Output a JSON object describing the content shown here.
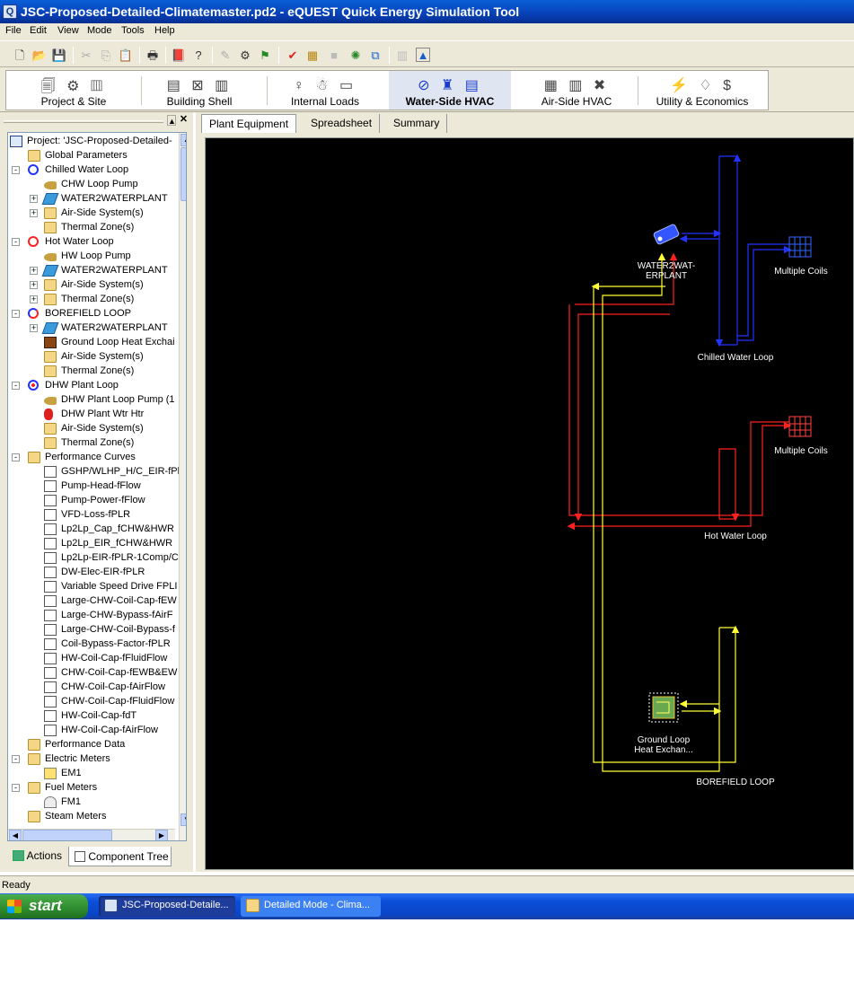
{
  "window": {
    "title": "JSC-Proposed-Detailed-Climatemaster.pd2 - eQUEST Quick Energy Simulation Tool"
  },
  "menu": [
    "File",
    "Edit",
    "View",
    "Mode",
    "Tools",
    "Help"
  ],
  "toolbar_icons": [
    "new-file",
    "open-folder",
    "save",
    "cut",
    "copy",
    "paste",
    "print",
    "library",
    "help",
    "edit-component",
    "wizard",
    "flag",
    "check",
    "spreadsheet",
    "blank",
    "gear",
    "link",
    "blank",
    "image"
  ],
  "modes": [
    {
      "label": "Project & Site",
      "icons": "🗐 ⚙ ▥",
      "active": false
    },
    {
      "label": "Building Shell",
      "icons": "▤ ⊠ ▥",
      "active": false
    },
    {
      "label": "Internal Loads",
      "icons": "♀ ☃ ▭",
      "active": false
    },
    {
      "label": "Water-Side HVAC",
      "icons": "⊘ ♜ ▤",
      "active": true
    },
    {
      "label": "Air-Side HVAC",
      "icons": "▦ ▥ ✖",
      "active": false
    },
    {
      "label": "Utility & Economics",
      "icons": "⚡ ♢ $",
      "active": false
    }
  ],
  "tree": [
    {
      "label": "Project:  'JSC-Proposed-Detailed-",
      "level": 0,
      "icon": "project-icon",
      "exp": ""
    },
    {
      "label": "Global Parameters",
      "level": 1,
      "icon": "folder",
      "exp": ""
    },
    {
      "label": "Chilled Water Loop",
      "level": 1,
      "icon": "chw-loop",
      "exp": "-"
    },
    {
      "label": "CHW Loop Pump",
      "level": 2,
      "icon": "pump",
      "exp": ""
    },
    {
      "label": "WATER2WATERPLANT",
      "level": 2,
      "icon": "plant",
      "exp": "+"
    },
    {
      "label": "Air-Side System(s)",
      "level": 2,
      "icon": "folder",
      "exp": "+"
    },
    {
      "label": "Thermal Zone(s)",
      "level": 2,
      "icon": "folder",
      "exp": ""
    },
    {
      "label": "Hot Water Loop",
      "level": 1,
      "icon": "hw-loop",
      "exp": "-"
    },
    {
      "label": "HW Loop Pump",
      "level": 2,
      "icon": "pump",
      "exp": ""
    },
    {
      "label": "WATER2WATERPLANT",
      "level": 2,
      "icon": "plant",
      "exp": "+"
    },
    {
      "label": "Air-Side System(s)",
      "level": 2,
      "icon": "folder",
      "exp": "+"
    },
    {
      "label": "Thermal Zone(s)",
      "level": 2,
      "icon": "folder",
      "exp": "+"
    },
    {
      "label": "BOREFIELD LOOP",
      "level": 1,
      "icon": "bore-loop",
      "exp": "-"
    },
    {
      "label": "WATER2WATERPLANT",
      "level": 2,
      "icon": "plant",
      "exp": "+"
    },
    {
      "label": "Ground Loop Heat Exchai",
      "level": 2,
      "icon": "ground",
      "exp": ""
    },
    {
      "label": "Air-Side System(s)",
      "level": 2,
      "icon": "folder",
      "exp": ""
    },
    {
      "label": "Thermal Zone(s)",
      "level": 2,
      "icon": "folder",
      "exp": ""
    },
    {
      "label": "DHW Plant Loop",
      "level": 1,
      "icon": "dhw-loop",
      "exp": "-"
    },
    {
      "label": "DHW Plant Loop Pump (1",
      "level": 2,
      "icon": "pump",
      "exp": ""
    },
    {
      "label": "DHW Plant Wtr Htr",
      "level": 2,
      "icon": "heater",
      "exp": ""
    },
    {
      "label": "Air-Side System(s)",
      "level": 2,
      "icon": "folder",
      "exp": ""
    },
    {
      "label": "Thermal Zone(s)",
      "level": 2,
      "icon": "folder",
      "exp": ""
    },
    {
      "label": "Performance Curves",
      "level": 1,
      "icon": "folder",
      "exp": "-"
    },
    {
      "label": "GSHP/WLHP_H/C_EIR-fPl",
      "level": 2,
      "icon": "curve",
      "exp": ""
    },
    {
      "label": "Pump-Head-fFlow",
      "level": 2,
      "icon": "curve",
      "exp": ""
    },
    {
      "label": "Pump-Power-fFlow",
      "level": 2,
      "icon": "curve",
      "exp": ""
    },
    {
      "label": "VFD-Loss-fPLR",
      "level": 2,
      "icon": "curve",
      "exp": ""
    },
    {
      "label": "Lp2Lp_Cap_fCHW&HWR",
      "level": 2,
      "icon": "curve",
      "exp": ""
    },
    {
      "label": "Lp2Lp_EIR_fCHW&HWR",
      "level": 2,
      "icon": "curve",
      "exp": ""
    },
    {
      "label": "Lp2Lp-EIR-fPLR-1Comp/C",
      "level": 2,
      "icon": "curve",
      "exp": ""
    },
    {
      "label": "DW-Elec-EIR-fPLR",
      "level": 2,
      "icon": "curve",
      "exp": ""
    },
    {
      "label": "Variable Speed Drive FPLI",
      "level": 2,
      "icon": "curve",
      "exp": ""
    },
    {
      "label": "Large-CHW-Coil-Cap-fEW",
      "level": 2,
      "icon": "curve",
      "exp": ""
    },
    {
      "label": "Large-CHW-Bypass-fAirF",
      "level": 2,
      "icon": "curve",
      "exp": ""
    },
    {
      "label": "Large-CHW-Coil-Bypass-f",
      "level": 2,
      "icon": "curve",
      "exp": ""
    },
    {
      "label": "Coil-Bypass-Factor-fPLR",
      "level": 2,
      "icon": "curve",
      "exp": ""
    },
    {
      "label": "HW-Coil-Cap-fFluidFlow",
      "level": 2,
      "icon": "curve",
      "exp": ""
    },
    {
      "label": "CHW-Coil-Cap-fEWB&EW",
      "level": 2,
      "icon": "curve",
      "exp": ""
    },
    {
      "label": "CHW-Coil-Cap-fAirFlow",
      "level": 2,
      "icon": "curve",
      "exp": ""
    },
    {
      "label": "CHW-Coil-Cap-fFluidFlow",
      "level": 2,
      "icon": "curve",
      "exp": ""
    },
    {
      "label": "HW-Coil-Cap-fdT",
      "level": 2,
      "icon": "curve",
      "exp": ""
    },
    {
      "label": "HW-Coil-Cap-fAirFlow",
      "level": 2,
      "icon": "curve",
      "exp": ""
    },
    {
      "label": "Performance Data",
      "level": 1,
      "icon": "folder",
      "exp": ""
    },
    {
      "label": "Electric Meters",
      "level": 1,
      "icon": "folder",
      "exp": "-"
    },
    {
      "label": "EM1",
      "level": 2,
      "icon": "elec-meter",
      "exp": ""
    },
    {
      "label": "Fuel Meters",
      "level": 1,
      "icon": "folder",
      "exp": "-"
    },
    {
      "label": "FM1",
      "level": 2,
      "icon": "fuel-meter",
      "exp": ""
    },
    {
      "label": "Steam Meters",
      "level": 1,
      "icon": "folder",
      "exp": ""
    }
  ],
  "left_tabs": {
    "actions": "Actions",
    "component_tree": "Component Tree"
  },
  "right_tabs": [
    "Plant Equipment",
    "Spreadsheet",
    "Summary"
  ],
  "diagram": {
    "chiller_label": "WATER2WAT-\nERPLANT",
    "chw_loop_label": "Chilled Water Loop",
    "chw_coils_label": "Multiple Coils",
    "hw_loop_label": "Hot Water Loop",
    "hw_coils_label": "Multiple Coils",
    "ghx_label": "Ground Loop\nHeat Exchan...",
    "bore_loop_label": "BOREFIELD LOOP",
    "colors": {
      "chw": "#2233ff",
      "hw": "#ff2020",
      "bore": "#ffff33"
    }
  },
  "status": {
    "text": "Ready"
  },
  "taskbar": {
    "start": "start",
    "tasks": [
      {
        "label": "JSC-Proposed-Detaile...",
        "active": true
      },
      {
        "label": "Detailed Mode - Clima...",
        "active": false
      }
    ]
  }
}
